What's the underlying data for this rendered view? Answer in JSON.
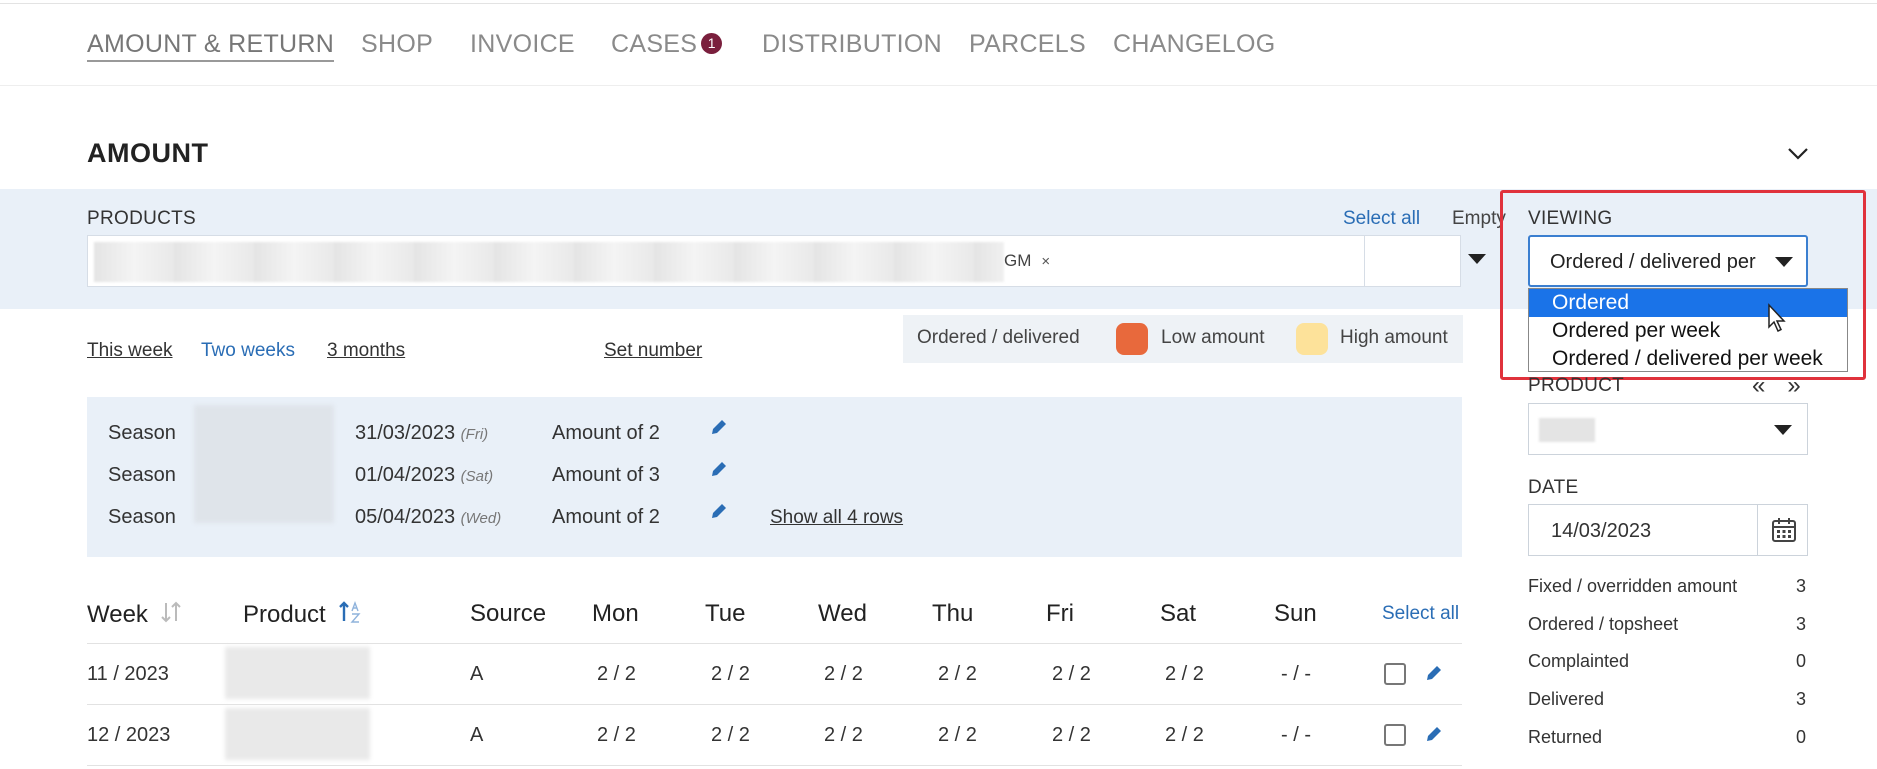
{
  "tabs": [
    {
      "label": "AMOUNT & RETURN",
      "active": true
    },
    {
      "label": "SHOP"
    },
    {
      "label": "INVOICE"
    },
    {
      "label": "CASES",
      "badge": "1"
    },
    {
      "label": "DISTRIBUTION"
    },
    {
      "label": "PARCELS"
    },
    {
      "label": "CHANGELOG"
    }
  ],
  "section": {
    "title": "AMOUNT"
  },
  "products": {
    "label": "PRODUCTS",
    "select_all": "Select all",
    "empty": "Empty",
    "chip": "GM",
    "chip_remove": "×"
  },
  "viewing": {
    "label": "VIEWING",
    "value": "Ordered / delivered per week",
    "options": [
      "Ordered",
      "Ordered per week",
      "Ordered / delivered per week"
    ],
    "selected_index": 0
  },
  "ranges": {
    "this_week": "This week",
    "two_weeks": "Two weeks",
    "three_months": "3 months",
    "set_number": "Set number"
  },
  "legend": {
    "ordered_delivered": "Ordered / delivered",
    "low": "Low amount",
    "high": "High amount",
    "low_color": "#e8693c",
    "high_color": "#fde29a"
  },
  "seasons": {
    "rows": [
      {
        "label": "Season",
        "date": "31/03/2023",
        "day": "(Fri)",
        "amount": "Amount of 2"
      },
      {
        "label": "Season",
        "date": "01/04/2023",
        "day": "(Sat)",
        "amount": "Amount of 3"
      },
      {
        "label": "Season",
        "date": "05/04/2023",
        "day": "(Wed)",
        "amount": "Amount of 2"
      }
    ],
    "show_all": "Show all 4 rows"
  },
  "table": {
    "headers": {
      "week": "Week",
      "product": "Product",
      "source": "Source",
      "mon": "Mon",
      "tue": "Tue",
      "wed": "Wed",
      "thu": "Thu",
      "fri": "Fri",
      "sat": "Sat",
      "sun": "Sun",
      "select_all": "Select all"
    },
    "rows": [
      {
        "week": "11 / 2023",
        "source": "A",
        "mon": "2 / 2",
        "tue": "2 / 2",
        "wed": "2 / 2",
        "thu": "2 / 2",
        "fri": "2 / 2",
        "sat": "2 / 2",
        "sun": "- / -"
      },
      {
        "week": "12 / 2023",
        "source": "A",
        "mon": "2 / 2",
        "tue": "2 / 2",
        "wed": "2 / 2",
        "thu": "2 / 2",
        "fri": "2 / 2",
        "sat": "2 / 2",
        "sun": "- / -"
      }
    ]
  },
  "side": {
    "product_label": "PRODUCT",
    "prev": "«",
    "next": "»",
    "date_label": "DATE",
    "date_value": "14/03/2023",
    "stats": [
      {
        "label": "Fixed / overridden amount",
        "value": "3"
      },
      {
        "label": "Ordered / topsheet",
        "value": "3"
      },
      {
        "label": "Complainted",
        "value": "0"
      },
      {
        "label": "Delivered",
        "value": "3"
      },
      {
        "label": "Returned",
        "value": "0"
      }
    ]
  }
}
